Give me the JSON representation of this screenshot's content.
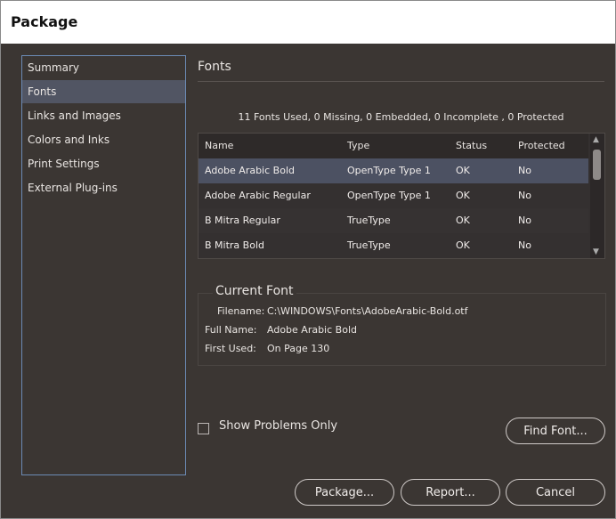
{
  "window": {
    "title": "Package"
  },
  "sidebar": {
    "items": [
      {
        "label": "Summary",
        "selected": false
      },
      {
        "label": "Fonts",
        "selected": true
      },
      {
        "label": "Links and Images",
        "selected": false
      },
      {
        "label": "Colors and Inks",
        "selected": false
      },
      {
        "label": "Print Settings",
        "selected": false
      },
      {
        "label": "External Plug-ins",
        "selected": false
      }
    ]
  },
  "main": {
    "section_title": "Fonts",
    "summary": "11 Fonts Used, 0 Missing, 0 Embedded, 0 Incomplete , 0 Protected",
    "table": {
      "columns": [
        "Name",
        "Type",
        "Status",
        "Protected"
      ],
      "rows": [
        {
          "name": "Adobe Arabic Bold",
          "type": "OpenType Type 1",
          "status": "OK",
          "protected": "No",
          "selected": true
        },
        {
          "name": "Adobe Arabic Regular",
          "type": "OpenType Type 1",
          "status": "OK",
          "protected": "No",
          "selected": false
        },
        {
          "name": "B Mitra Regular",
          "type": "TrueType",
          "status": "OK",
          "protected": "No",
          "selected": false
        },
        {
          "name": "B Mitra Bold",
          "type": "TrueType",
          "status": "OK",
          "protected": "No",
          "selected": false
        }
      ]
    },
    "current_font": {
      "title": "Current Font",
      "filename_label": "Filename:",
      "filename": "C:\\WINDOWS\\Fonts\\AdobeArabic-Bold.otf",
      "fullname_label": "Full Name:",
      "fullname": "Adobe Arabic Bold",
      "firstused_label": "First Used:",
      "firstused": "On Page 130"
    },
    "show_problems_label": "Show Problems Only",
    "show_problems_checked": false,
    "find_font_button": "Find Font..."
  },
  "footer": {
    "package_button": "Package...",
    "report_button": "Report...",
    "cancel_button": "Cancel"
  },
  "colors": {
    "panel_bg": "#3b3633",
    "selection": "#4c5162",
    "sidebar_border": "#6c8bb5"
  }
}
